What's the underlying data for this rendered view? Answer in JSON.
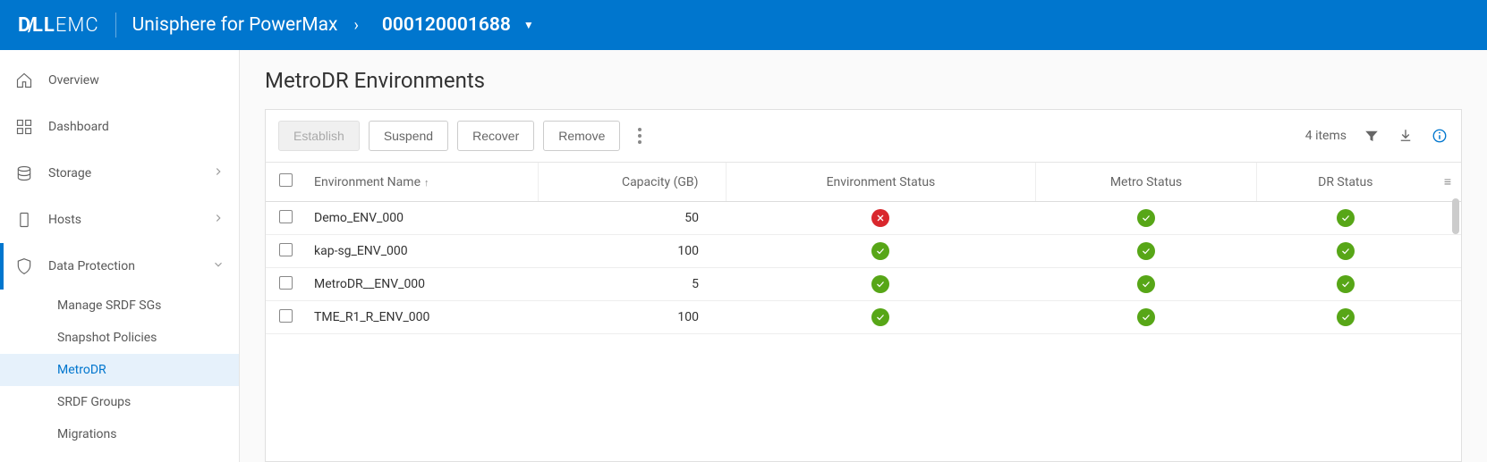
{
  "header": {
    "brand_prefix": "D",
    "brand_mid": "LL",
    "brand_suffix": "EMC",
    "app": "Unisphere for PowerMax",
    "system_id": "000120001688"
  },
  "sidebar": {
    "items": [
      {
        "label": "Overview",
        "icon": "home"
      },
      {
        "label": "Dashboard",
        "icon": "dashboard"
      },
      {
        "label": "Storage",
        "icon": "storage",
        "expandable": true
      },
      {
        "label": "Hosts",
        "icon": "hosts",
        "expandable": true
      },
      {
        "label": "Data Protection",
        "icon": "shield",
        "expandable": true,
        "expanded": true,
        "active": true
      }
    ],
    "sub": [
      {
        "label": "Manage SRDF SGs"
      },
      {
        "label": "Snapshot Policies"
      },
      {
        "label": "MetroDR",
        "active": true
      },
      {
        "label": "SRDF Groups"
      },
      {
        "label": "Migrations"
      }
    ]
  },
  "page": {
    "title": "MetroDR Environments"
  },
  "toolbar": {
    "buttons": [
      {
        "label": "Establish",
        "disabled": true
      },
      {
        "label": "Suspend"
      },
      {
        "label": "Recover"
      },
      {
        "label": "Remove"
      }
    ],
    "count_label": "4 items"
  },
  "table": {
    "columns": [
      "Environment Name",
      "Capacity (GB)",
      "Environment Status",
      "Metro Status",
      "DR Status"
    ],
    "rows": [
      {
        "name": "Demo_ENV_000",
        "capacity": "50",
        "env_status": "error",
        "metro_status": "ok",
        "dr_status": "ok"
      },
      {
        "name": "kap-sg_ENV_000",
        "capacity": "100",
        "env_status": "ok",
        "metro_status": "ok",
        "dr_status": "ok"
      },
      {
        "name": "MetroDR__ENV_000",
        "capacity": "5",
        "env_status": "ok",
        "metro_status": "ok",
        "dr_status": "ok"
      },
      {
        "name": "TME_R1_R_ENV_000",
        "capacity": "100",
        "env_status": "ok",
        "metro_status": "ok",
        "dr_status": "ok"
      }
    ]
  }
}
